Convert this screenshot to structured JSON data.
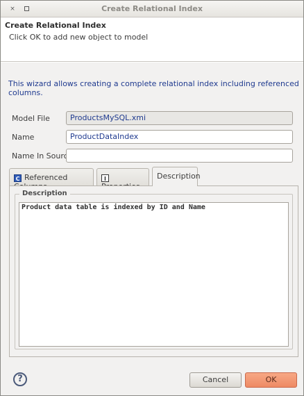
{
  "window": {
    "title": "Create Relational Index",
    "close_glyph": "×"
  },
  "header": {
    "title": "Create Relational Index",
    "message": "Click OK to add new object to model"
  },
  "description": "This wizard allows creating a complete relational index including referenced columns.",
  "form": {
    "model_file_label": "Model File",
    "model_file_value": "ProductsMySQL.xmi",
    "name_label": "Name",
    "name_value": "ProductDataIndex",
    "name_in_source_label": "Name In Source",
    "name_in_source_value": ""
  },
  "tabs": [
    {
      "label": "Referenced Columns",
      "icon": "C"
    },
    {
      "label": "Properties",
      "icon": "I"
    },
    {
      "label": "Description"
    }
  ],
  "description_tab": {
    "group_label": "Description",
    "text": "Product data table is indexed by ID and Name"
  },
  "footer": {
    "help_glyph": "?",
    "cancel_label": "Cancel",
    "ok_label": "OK"
  },
  "colors": {
    "link_blue": "#1f3a8f",
    "ok_button": "#ee8a64"
  }
}
